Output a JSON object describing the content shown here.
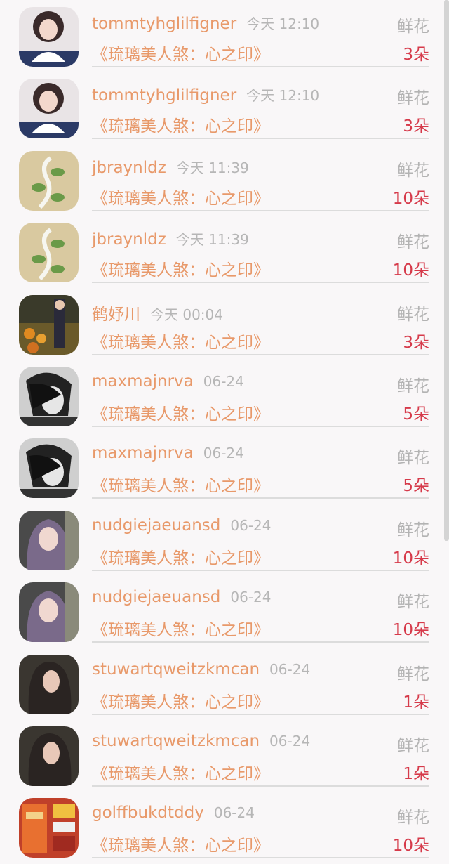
{
  "rows": [
    {
      "name": "tommtyhglilfigner",
      "time": "今天 12:10",
      "gift_label": "鲜花",
      "title": "《琉璃美人煞：心之印》",
      "count": "3朵",
      "avatar": "girl-white-top-avatar"
    },
    {
      "name": "tommtyhglilfigner",
      "time": "今天 12:10",
      "gift_label": "鲜花",
      "title": "《琉璃美人煞：心之印》",
      "count": "3朵",
      "avatar": "girl-white-top-avatar"
    },
    {
      "name": "jbraynldz",
      "time": "今天 11:39",
      "gift_label": "鲜花",
      "title": "《琉璃美人煞：心之印》",
      "count": "10朵",
      "avatar": "plant-illustration-avatar"
    },
    {
      "name": "jbraynldz",
      "time": "今天 11:39",
      "gift_label": "鲜花",
      "title": "《琉璃美人煞：心之印》",
      "count": "10朵",
      "avatar": "plant-illustration-avatar"
    },
    {
      "name": "鹤妤川",
      "time": "今天 00:04",
      "gift_label": "鲜花",
      "title": "《琉璃美人煞：心之印》",
      "count": "3朵",
      "avatar": "flower-field-avatar"
    },
    {
      "name": "maxmajnrva",
      "time": "06-24",
      "gift_label": "鲜花",
      "title": "《琉璃美人煞：心之印》",
      "count": "5朵",
      "avatar": "bw-portrait-avatar"
    },
    {
      "name": "maxmajnrva",
      "time": "06-24",
      "gift_label": "鲜花",
      "title": "《琉璃美人煞：心之印》",
      "count": "5朵",
      "avatar": "bw-portrait-avatar"
    },
    {
      "name": "nudgiejaeuansd",
      "time": "06-24",
      "gift_label": "鲜花",
      "title": "《琉璃美人煞：心之印》",
      "count": "10朵",
      "avatar": "purple-hair-avatar"
    },
    {
      "name": "nudgiejaeuansd",
      "time": "06-24",
      "gift_label": "鲜花",
      "title": "《琉璃美人煞：心之印》",
      "count": "10朵",
      "avatar": "purple-hair-avatar"
    },
    {
      "name": "stuwartqweitzkmcan",
      "time": "06-24",
      "gift_label": "鲜花",
      "title": "《琉璃美人煞：心之印》",
      "count": "1朵",
      "avatar": "dark-hair-avatar"
    },
    {
      "name": "stuwartqweitzkmcan",
      "time": "06-24",
      "gift_label": "鲜花",
      "title": "《琉璃美人煞：心之印》",
      "count": "1朵",
      "avatar": "dark-hair-avatar"
    },
    {
      "name": "golffbukdtddy",
      "time": "06-24",
      "gift_label": "鲜花",
      "title": "《琉璃美人煞：心之印》",
      "count": "10朵",
      "avatar": "php-poster-avatar"
    }
  ],
  "avatar_colors": {
    "girl-white-top-avatar": "#2b3a66",
    "plant-illustration-avatar": "#d9c9a0",
    "flower-field-avatar": "#6a5a2a",
    "bw-portrait-avatar": "#cfcfcf",
    "purple-hair-avatar": "#7a6a8a",
    "dark-hair-avatar": "#2a2422",
    "php-poster-avatar": "#c0402a"
  }
}
